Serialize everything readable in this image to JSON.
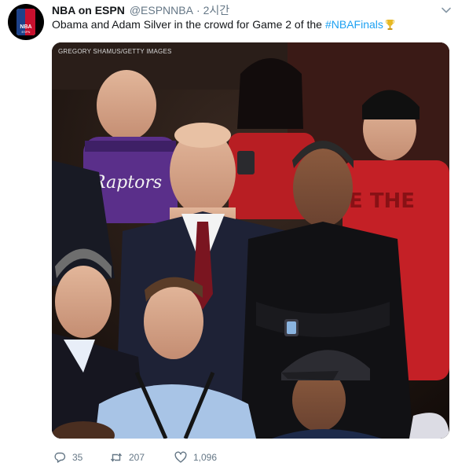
{
  "tweet": {
    "display_name": "NBA on ESPN",
    "handle": "@ESPNNBA",
    "separator": "·",
    "time": "2시간",
    "text": "Obama and Adam Silver in the crowd for Game 2 of the",
    "hashtag": "#NBAFinals",
    "photo_credit": "GREGORY SHAMUS/GETTY IMAGES",
    "avatar_logo_text": "NBA",
    "avatar_logo_sub": "ESPN"
  },
  "actions": {
    "replies": "35",
    "retweets": "207",
    "likes": "1,096"
  },
  "icons": {
    "avatar": "nba-espn-logo",
    "caret": "chevron-down-icon",
    "trophy": "trophy-icon",
    "reply": "reply-icon",
    "retweet": "retweet-icon",
    "like": "heart-icon"
  },
  "colors": {
    "link": "#1da1f2",
    "secondary_text": "#657786",
    "primary_text": "#14171a",
    "raptors_red": "#c8102e"
  }
}
